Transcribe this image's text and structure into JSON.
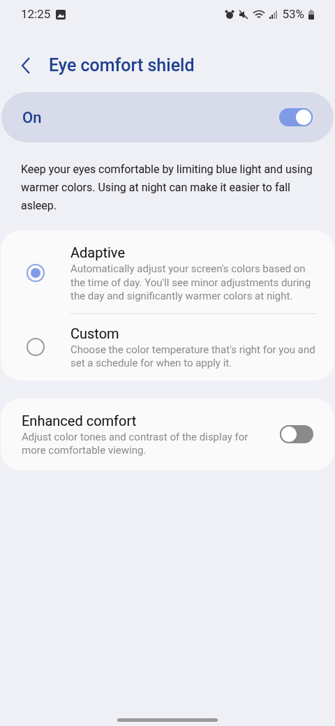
{
  "status_bar": {
    "time": "12:25",
    "battery": "53%"
  },
  "header": {
    "title": "Eye comfort shield"
  },
  "master": {
    "label": "On",
    "on": true
  },
  "description": "Keep your eyes comfortable by limiting blue light and using warmer colors. Using at night can make it easier to fall asleep.",
  "modes": [
    {
      "title": "Adaptive",
      "summary": "Automatically adjust your screen's colors based on the time of day. You'll see minor adjustments during the day and significantly warmer colors at night.",
      "selected": true
    },
    {
      "title": "Custom",
      "summary": "Choose the color temperature that's right for you and set a schedule for when to apply it.",
      "selected": false
    }
  ],
  "enhanced": {
    "title": "Enhanced comfort",
    "summary": "Adjust color tones and contrast of the display for more comfortable viewing.",
    "on": false
  }
}
